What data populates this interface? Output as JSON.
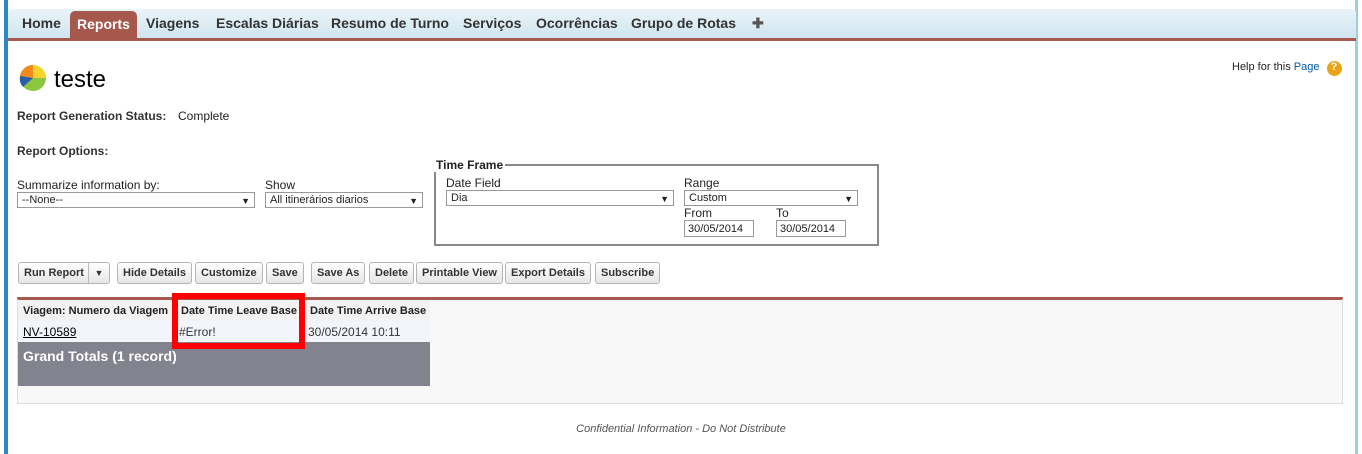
{
  "tabs": [
    "Home",
    "Reports",
    "Viagens",
    "Escalas Diárias",
    "Resumo de Turno",
    "Serviços",
    "Ocorrências",
    "Grupo de Rotas",
    "✚"
  ],
  "title": "teste",
  "help": {
    "text": "Help for this ",
    "link": "Page",
    "icon": "question-icon"
  },
  "status": {
    "label": "Report Generation Status:",
    "value": "Complete"
  },
  "options": {
    "label": "Report Options:",
    "summarize_label": "Summarize information by:",
    "summarize_value": "--None--",
    "show_label": "Show",
    "show_value": "All itinerários diarios"
  },
  "time_frame": {
    "legend": "Time Frame",
    "date_field_label": "Date Field",
    "date_field_value": "Dia",
    "range_label": "Range",
    "range_value": "Custom",
    "from_label": "From",
    "from_value": "30/05/2014",
    "to_label": "To",
    "to_value": "30/05/2014"
  },
  "buttons": [
    "Run Report",
    "Hide Details",
    "Customize",
    "Save",
    "Save As",
    "Delete",
    "Printable View",
    "Export Details",
    "Subscribe"
  ],
  "table": {
    "headers": [
      "Viagem: Numero da Viagem",
      "Date Time Leave Base",
      "Date Time Arrive Base"
    ],
    "row": [
      "NV-10589",
      "#Error!",
      "30/05/2014 10:11"
    ],
    "grand_totals": "Grand Totals (1 record)"
  },
  "footer": "Confidential Information - Do Not Distribute",
  "colors": {
    "accent": "#a5584b",
    "highlight": "#ff0000"
  }
}
